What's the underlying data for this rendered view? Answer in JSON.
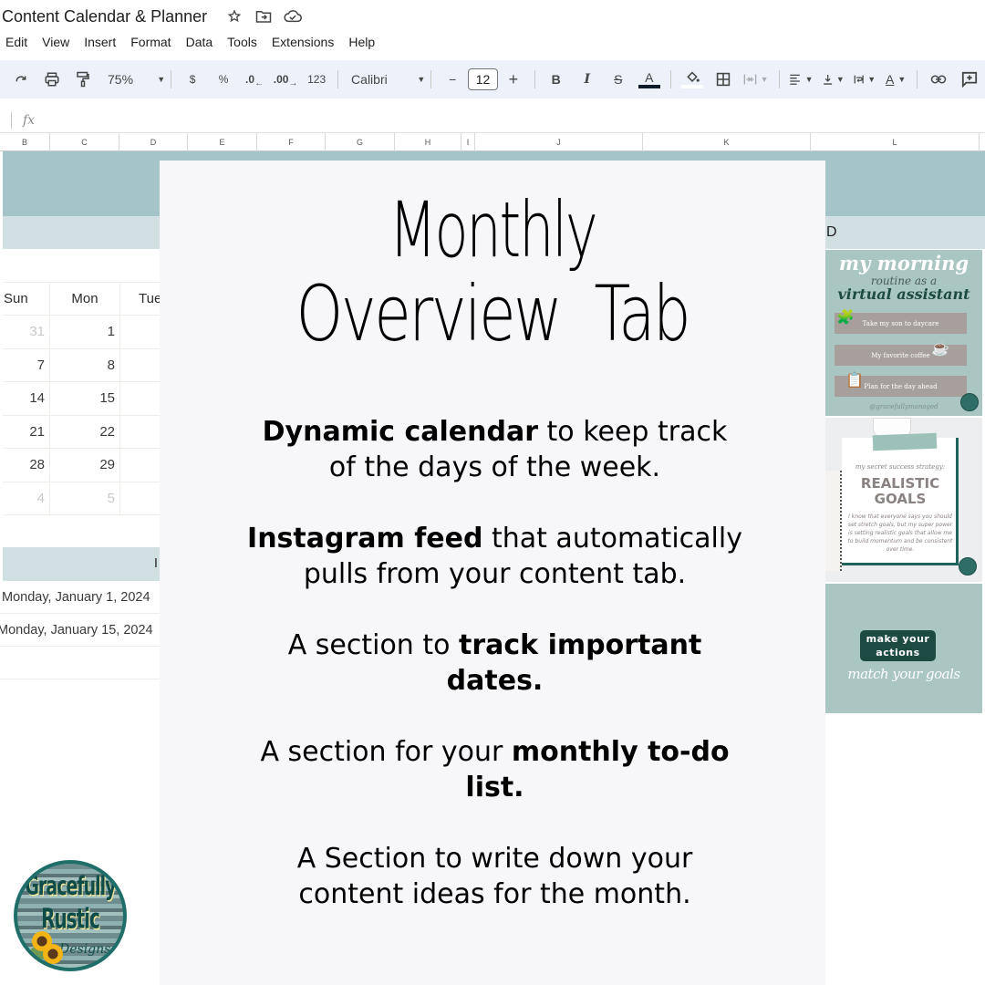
{
  "app": {
    "title": "Content Calendar & Planner",
    "title_icons": [
      "star-icon",
      "move-to-folder-icon",
      "cloud-saved-icon"
    ]
  },
  "menu": [
    "Edit",
    "View",
    "Insert",
    "Format",
    "Data",
    "Tools",
    "Extensions",
    "Help"
  ],
  "toolbar": {
    "redo": "↻",
    "print": "🖶",
    "paint_format": "⎍",
    "zoom": "75%",
    "currency": "$",
    "percent": "%",
    "decrease_decimal": ".0",
    "increase_decimal": ".00",
    "number_format": "123",
    "font": "Calibri",
    "font_size": "12",
    "minus": "−",
    "plus": "+",
    "bold": "B",
    "italic": "I",
    "strikethrough": "S",
    "text_color": "A",
    "text_color_value": "#0d1b2a",
    "fill_color_value": "#ffffff",
    "borders": "⊞",
    "merge": "⇹",
    "align": "≡",
    "valign": "⤓",
    "wrap": "⇥",
    "rotate": "A",
    "link": "🔗",
    "comment": "⊕"
  },
  "formula_bar": {
    "fx_label": "fx",
    "value": ""
  },
  "columns": [
    "B",
    "C",
    "D",
    "E",
    "F",
    "G",
    "H",
    "I",
    "J",
    "K",
    "L"
  ],
  "sheet": {
    "band_color": "#a4c4c8",
    "subband_color": "#d1e0e3",
    "band_partial_text": "D",
    "calendar": {
      "headers": [
        "Sun",
        "Mon",
        "Tue"
      ],
      "rows": [
        [
          {
            "v": "31",
            "muted": true
          },
          {
            "v": "1",
            "muted": false
          }
        ],
        [
          {
            "v": "7",
            "muted": false
          },
          {
            "v": "8",
            "muted": false
          }
        ],
        [
          {
            "v": "14",
            "muted": false
          },
          {
            "v": "15",
            "muted": false
          }
        ],
        [
          {
            "v": "21",
            "muted": false
          },
          {
            "v": "22",
            "muted": false
          }
        ],
        [
          {
            "v": "28",
            "muted": false
          },
          {
            "v": "29",
            "muted": false
          }
        ],
        [
          {
            "v": "4",
            "muted": true
          },
          {
            "v": "5",
            "muted": true
          }
        ]
      ]
    },
    "important_dates": {
      "header_partial": "I",
      "rows": [
        "Monday, January 1, 2024",
        "Monday, January 15, 2024",
        ""
      ]
    }
  },
  "overlay": {
    "title_line1": "Monthly",
    "title_line2": "Overview  Tab",
    "features": [
      {
        "bold": "Dynamic calendar",
        "rest": " to keep track of the days of the week.",
        "bold_first": true
      },
      {
        "bold": "Instagram feed",
        "rest": " that automatically pulls from your content tab.",
        "bold_first": true
      },
      {
        "pre": "A section to ",
        "bold": "track important dates.",
        "bold_first": false
      },
      {
        "pre": "A section for your ",
        "bold": "monthly to-do list.",
        "bold_first": false
      },
      {
        "pre": "A Section to write down your content ideas for the month.",
        "bold": "",
        "bold_first": false
      }
    ]
  },
  "instagram_feed": {
    "post1": {
      "title": "my morning",
      "subtitle": "routine as a",
      "title2": "virtual assistant",
      "items": [
        "Take my son to daycare",
        "My favorite coffee",
        "Plan for the day ahead"
      ],
      "item_icons": [
        "blocks-icon",
        "coffee-cup-icon",
        "clipboard-icon"
      ],
      "handle": "@gracefullymanaged"
    },
    "post2": {
      "kicker": "my secret success strategy:",
      "title": "REALISTIC GOALS",
      "body": "I know that everyone says you should set stretch goals, but my super power is setting realistic goals that allow me to build momentum and be consistent over time."
    },
    "post3": {
      "box_text": "make your actions",
      "script_text": "match your goals"
    }
  },
  "logo": {
    "line1": "Gracefully",
    "line2": "Rustic",
    "line3": "Designs"
  }
}
